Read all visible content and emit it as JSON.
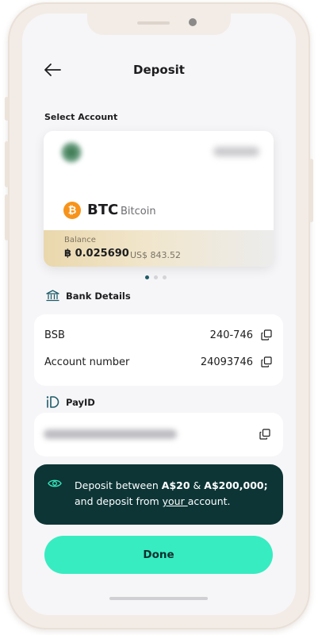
{
  "header": {
    "title": "Deposit",
    "back_icon": "arrow-left-icon"
  },
  "select_account": {
    "label": "Select Account",
    "card": {
      "coin_code": "BTC",
      "coin_name": "Bitcoin",
      "coin_icon": "bitcoin-icon",
      "balance_label": "Balance",
      "balance_value": "฿ 0.025690",
      "balance_usd": "US$ 843.52"
    },
    "carousel": {
      "active_index": 0,
      "count": 3
    }
  },
  "bank_details": {
    "heading": "Bank Details",
    "icon": "bank-icon",
    "rows": [
      {
        "label": "BSB",
        "value": "240-746"
      },
      {
        "label": "Account number",
        "value": "24093746"
      }
    ]
  },
  "payid": {
    "heading": "PayID",
    "icon": "payid-icon"
  },
  "notice": {
    "icon": "eye-icon",
    "text_prefix": "Deposit between ",
    "min_amount": "A$20",
    "connector": " & ",
    "max_amount": "A$200,000;",
    "line2_prefix": "and deposit from ",
    "emphasis": "your ",
    "line2_suffix": "account."
  },
  "done_button": {
    "label": "Done"
  },
  "colors": {
    "accent": "#37ecc1",
    "notice_bg": "#0d3536",
    "bitcoin": "#f7931a",
    "frame": "#f3ece6"
  }
}
